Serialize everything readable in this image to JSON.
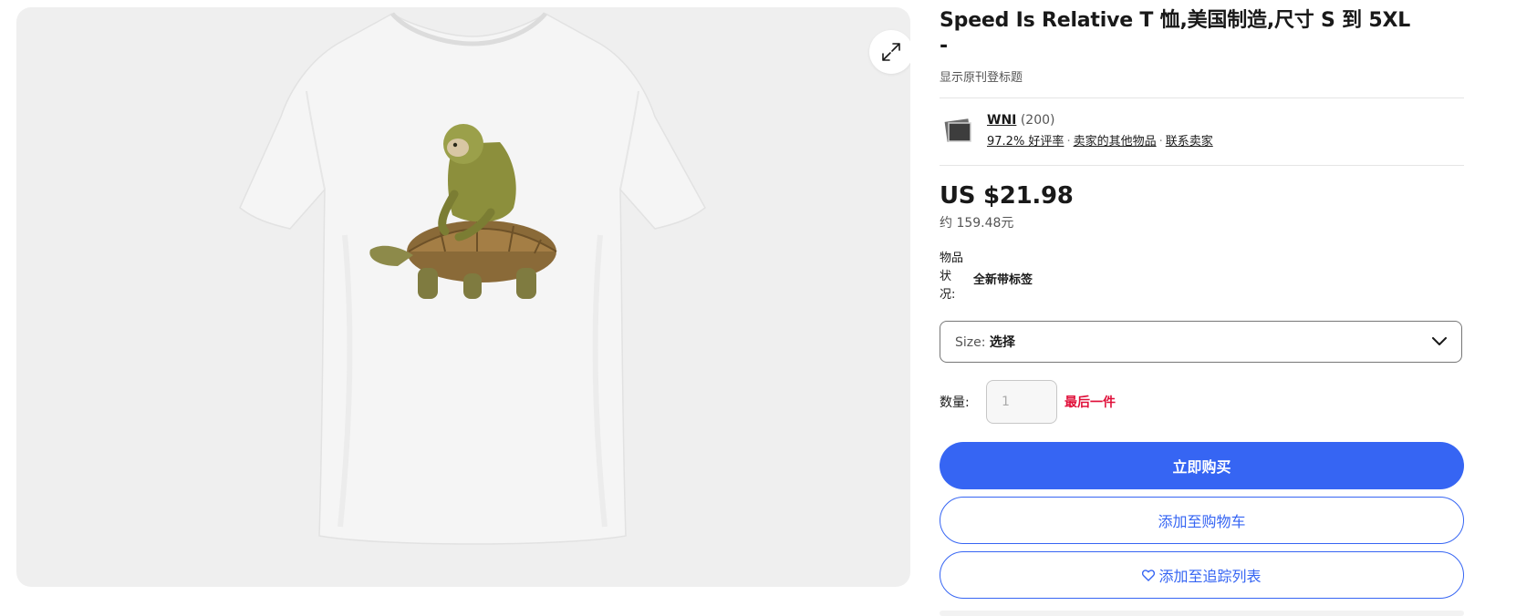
{
  "listing": {
    "title": "Speed Is Relative T 恤,美国制造,尺寸 S 到 5XL",
    "title_suffix": "-",
    "show_original_title": "显示原刊登标题"
  },
  "gallery": {
    "image_alt": "Sloth riding a tortoise T-shirt",
    "expand_icon": "expand-icon"
  },
  "seller": {
    "name": "WNI",
    "feedback_count": "(200)",
    "positive_rate": "97.2% 好评率",
    "other_items": "卖家的其他物品",
    "contact": "联系卖家",
    "separator": "·"
  },
  "price": {
    "main": "US $21.98",
    "approx": "约 159.48元"
  },
  "condition": {
    "label": "物品状况:",
    "value": "全新带标签"
  },
  "size_select": {
    "label": "Size:",
    "value": "选择",
    "icon": "chevron-down-icon"
  },
  "quantity": {
    "label": "数量:",
    "value": "1",
    "notice": "最后一件"
  },
  "buttons": {
    "buy_now": "立即购买",
    "add_to_cart": "添加至购物车",
    "add_to_watchlist": "添加至追踪列表",
    "watch_icon": "heart-icon"
  },
  "colors": {
    "primary_blue": "#3665f3",
    "alert_red": "#e0103a"
  }
}
